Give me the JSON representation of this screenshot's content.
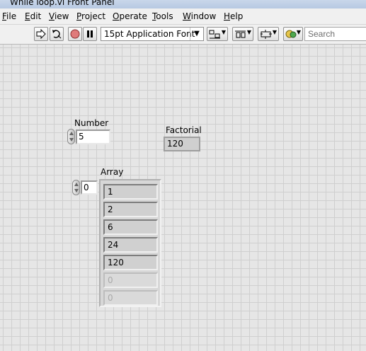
{
  "window": {
    "title": "While loop.vi Front Panel"
  },
  "menu": [
    {
      "label": "File",
      "accel": "F",
      "rest": "ile"
    },
    {
      "label": "Edit",
      "accel": "E",
      "rest": "dit"
    },
    {
      "label": "View",
      "accel": "V",
      "rest": "iew"
    },
    {
      "label": "Project",
      "accel": "P",
      "rest": "roject"
    },
    {
      "label": "Operate",
      "accel": "O",
      "rest": "perate"
    },
    {
      "label": "Tools",
      "accel": "T",
      "rest": "ools"
    },
    {
      "label": "Window",
      "accel": "W",
      "rest": "indow"
    },
    {
      "label": "Help",
      "accel": "H",
      "rest": "elp"
    }
  ],
  "toolbar": {
    "font": "15pt Application Font",
    "search_placeholder": "Search",
    "icons": [
      "run-arrow-icon",
      "run-continuously-icon",
      "abort-icon",
      "pause-icon",
      "align-objects-icon",
      "distribute-objects-icon",
      "resize-objects-icon",
      "reorder-icon"
    ]
  },
  "panel": {
    "number": {
      "label": "Number",
      "value": "5"
    },
    "factorial": {
      "label": "Factorial",
      "value": "120"
    },
    "array": {
      "label": "Array",
      "index": "0",
      "elements": [
        "1",
        "2",
        "6",
        "24",
        "120",
        "0",
        "0"
      ],
      "filled_count": 5
    }
  }
}
